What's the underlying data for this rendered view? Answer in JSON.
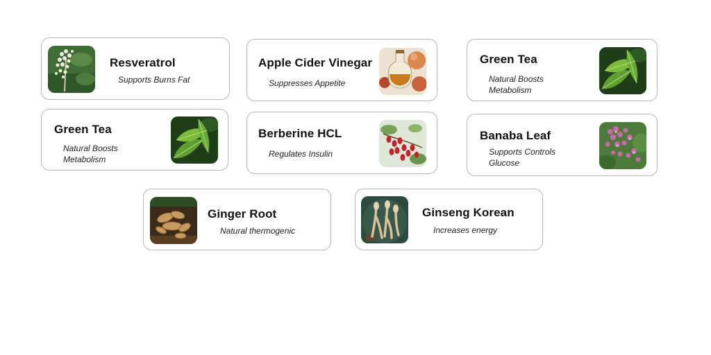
{
  "cards": [
    {
      "title": "Resveratrol",
      "description": "Supports Burns Fat",
      "icon": "knotweed-flower-icon"
    },
    {
      "title": "Apple Cider Vinegar",
      "description": "Suppresses Appetite",
      "icon": "vinegar-bottle-icon"
    },
    {
      "title": "Green Tea",
      "description": "Natural Boosts Metabolism",
      "icon": "tea-leaf-icon"
    },
    {
      "title": "Green Tea",
      "description": "Natural Boosts Metabolism",
      "icon": "tea-leaf-icon"
    },
    {
      "title": "Berberine HCL",
      "description": "Regulates Insulin",
      "icon": "barberry-icon"
    },
    {
      "title": "Banaba Leaf",
      "description": "Supports Controls Glucose",
      "icon": "banaba-flower-icon"
    },
    {
      "title": "Ginger Root",
      "description": "Natural thermogenic",
      "icon": "ginger-root-icon"
    },
    {
      "title": "Ginseng Korean",
      "description": "Increases energy",
      "icon": "ginseng-root-icon"
    }
  ]
}
